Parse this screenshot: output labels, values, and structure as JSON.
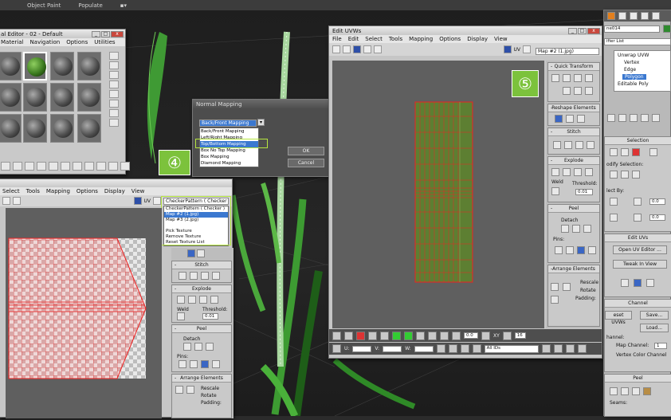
{
  "top_menu": [
    "Object Paint",
    "Populate"
  ],
  "material_editor": {
    "title": "al Editor - 02 - Default",
    "menu": [
      "Material",
      "Navigation",
      "Options",
      "Utilities"
    ]
  },
  "normal_mapping": {
    "title": "Normal Mapping",
    "selected": "Back/Front Mapping",
    "options": [
      "Back/Front Mapping",
      "Left/Right Mapping",
      "Top/Bottom Mapping",
      "Box No Top Mapping",
      "Box Mapping",
      "Diamond Mapping"
    ],
    "highlighted_index": 2,
    "ok_label": "OK",
    "cancel_label": "Cancel"
  },
  "uvw_small": {
    "menu": [
      "Select",
      "Tools",
      "Mapping",
      "Options",
      "Display",
      "View"
    ],
    "uv_label": "UV",
    "combo_value": "CheckerPattern ( Checker )",
    "dropdown": [
      "CheckerPattern ( Checker )",
      "Map #2 (1.jpg)",
      "Map #3 (2.jpg)",
      "",
      "Pick Texture",
      "Remove Texture",
      "Reset Texture List"
    ],
    "dropdown_selected": 1,
    "stitch": "Stitch",
    "explode": "Explode",
    "weld": "Weld",
    "threshold": "Threshold:",
    "threshold_val": "0.01",
    "peel": "Peel",
    "detach": "Detach",
    "pins": "Pins:",
    "arrange": "Arrange Elements",
    "rescale": "Rescale",
    "rotate": "Rotate",
    "padding": "Padding:"
  },
  "uvw_big": {
    "title": "Edit UVWs",
    "menu": [
      "File",
      "Edit",
      "Select",
      "Tools",
      "Mapping",
      "Options",
      "Display",
      "View"
    ],
    "uv_label": "UV",
    "map_value": "Map #2 (1.jpg)",
    "quick_transform": "Quick Transform",
    "reshape": "Reshape Elements",
    "stitch": "Stitch",
    "explode": "Explode",
    "weld": "Weld",
    "threshold": "Threshold:",
    "threshold_val": "0.01",
    "peel": "Peel",
    "detach": "Detach",
    "pins": "Pins:",
    "arrange": "Arrange Elements",
    "rescale": "Rescale",
    "rotate": "Rotate",
    "padding": "Padding:",
    "coord_u": "U:",
    "coord_v": "V:",
    "coord_w": "W:",
    "all_ids": "All IDs",
    "spin_val": "0.0",
    "xy_label": "XY",
    "spin16": "16"
  },
  "badges": {
    "four": "④",
    "five": "⑤"
  },
  "command_panel": {
    "object_name": "ne014",
    "modifier_list": "ifier List",
    "stack": [
      "Unwrap UVW",
      "Vertex",
      "Edge",
      "Polygon",
      "Editable Poly"
    ],
    "selection": "Selection",
    "modify_selection": "odify Selection:",
    "select_by": "lect By:",
    "spin_val": "0.0",
    "edit_uvs": "Edit UVs",
    "open_uv_editor": "Open UV Editor ...",
    "tweak_in_view": "Tweak In View",
    "channel": "Channel",
    "reset_uvws": "eset UVWs",
    "save": "Save...",
    "load": "Load...",
    "channel_lbl": "hannel:",
    "map_channel": "Map Channel:",
    "map_channel_val": "1",
    "vertex_color_channel": "Vertex Color Channel",
    "peel": "Peel",
    "seams": "Seams:"
  }
}
